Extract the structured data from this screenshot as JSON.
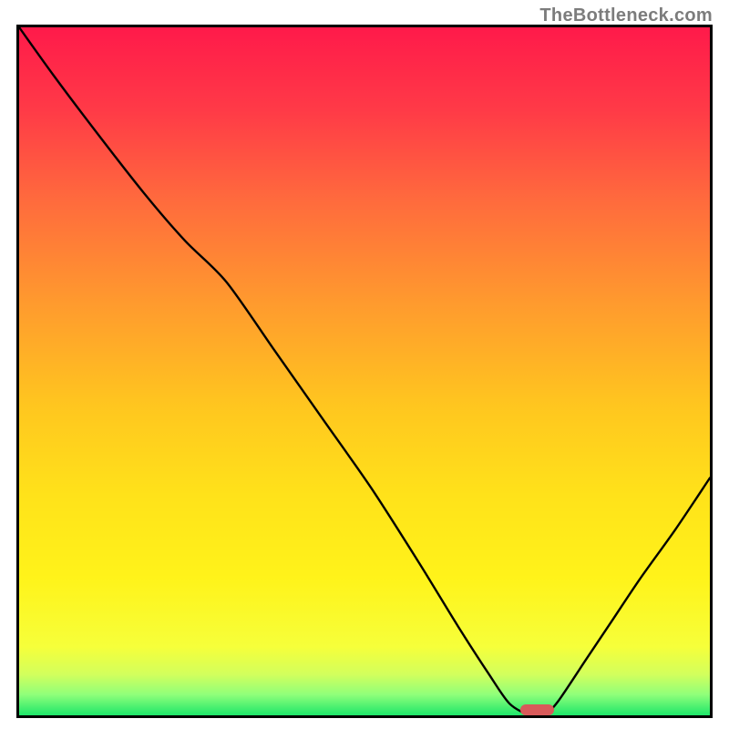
{
  "watermark": "TheBottleneck.com",
  "chart_data": {
    "type": "line",
    "title": "",
    "xlabel": "",
    "ylabel": "",
    "xlim": [
      0,
      100
    ],
    "ylim": [
      0,
      100
    ],
    "gradient_stops": [
      {
        "offset": 0.0,
        "color": "#ff1a4a"
      },
      {
        "offset": 0.12,
        "color": "#ff3a47"
      },
      {
        "offset": 0.25,
        "color": "#ff6a3d"
      },
      {
        "offset": 0.4,
        "color": "#ff9a2e"
      },
      {
        "offset": 0.55,
        "color": "#ffc61f"
      },
      {
        "offset": 0.68,
        "color": "#ffe21a"
      },
      {
        "offset": 0.8,
        "color": "#fff31a"
      },
      {
        "offset": 0.9,
        "color": "#f6ff3a"
      },
      {
        "offset": 0.94,
        "color": "#d3ff5c"
      },
      {
        "offset": 0.97,
        "color": "#8fff7a"
      },
      {
        "offset": 1.0,
        "color": "#1ee66a"
      }
    ],
    "series": [
      {
        "name": "bottleneck-curve",
        "x": [
          0.0,
          5.0,
          11.0,
          18.0,
          24.0,
          30.0,
          37.0,
          44.0,
          51.0,
          58.0,
          63.5,
          68.0,
          71.0,
          74.0,
          76.0,
          78.0,
          82.0,
          86.0,
          90.0,
          95.0,
          100.0
        ],
        "y": [
          100.0,
          93.0,
          85.0,
          76.0,
          69.0,
          63.0,
          53.0,
          43.0,
          33.0,
          22.0,
          13.0,
          6.0,
          1.7,
          0.0,
          0.0,
          2.0,
          8.0,
          14.0,
          20.0,
          27.0,
          34.5
        ]
      }
    ],
    "marker": {
      "name": "optimal-range",
      "x_center": 75.0,
      "width": 4.8,
      "y": 0.5,
      "height_pct": 1.6,
      "color": "#d85a5a"
    }
  }
}
